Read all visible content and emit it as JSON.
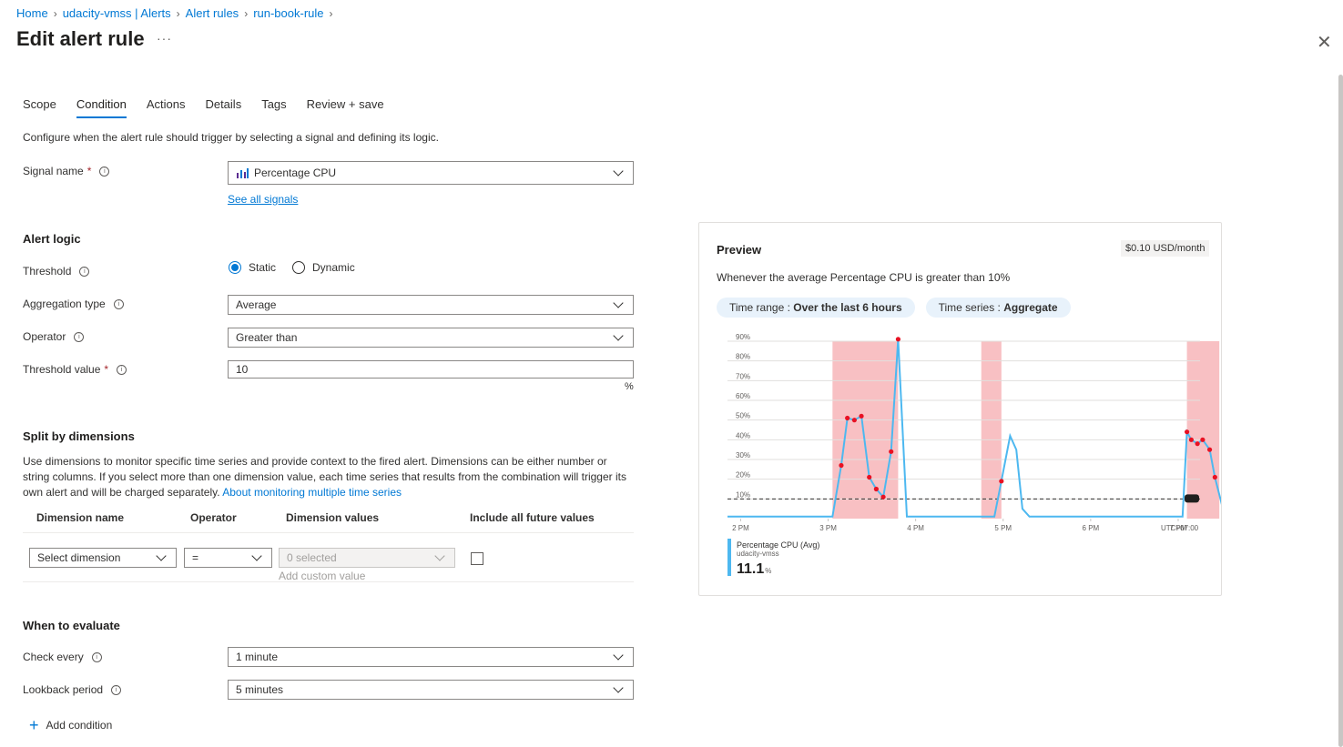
{
  "breadcrumb": [
    "Home",
    "udacity-vmss | Alerts",
    "Alert rules",
    "run-book-rule"
  ],
  "page_title": "Edit alert rule",
  "tabs": [
    "Scope",
    "Condition",
    "Actions",
    "Details",
    "Tags",
    "Review + save"
  ],
  "active_tab": "Condition",
  "description": "Configure when the alert rule should trigger by selecting a signal and defining its logic.",
  "signal": {
    "label": "Signal name",
    "value": "Percentage CPU",
    "see_all": "See all signals"
  },
  "alert_logic": {
    "heading": "Alert logic",
    "threshold_label": "Threshold",
    "threshold_options": [
      "Static",
      "Dynamic"
    ],
    "threshold_selected": "Static",
    "aggregation_label": "Aggregation type",
    "aggregation_value": "Average",
    "operator_label": "Operator",
    "operator_value": "Greater than",
    "threshold_value_label": "Threshold value",
    "threshold_value": "10",
    "unit": "%"
  },
  "split": {
    "heading": "Split by dimensions",
    "text": "Use dimensions to monitor specific time series and provide context to the fired alert. Dimensions can be either number or string columns. If you select more than one dimension value, each time series that results from the combination will trigger its own alert and will be charged separately.",
    "link": "About monitoring multiple time series",
    "columns": [
      "Dimension name",
      "Operator",
      "Dimension values",
      "Include all future values"
    ],
    "dimension_placeholder": "Select dimension",
    "operator_value": "=",
    "values_placeholder": "0 selected",
    "add_custom": "Add custom value"
  },
  "evaluate": {
    "heading": "When to evaluate",
    "check_label": "Check every",
    "check_value": "1 minute",
    "lookback_label": "Lookback period",
    "lookback_value": "5 minutes",
    "add_condition": "Add condition"
  },
  "preview": {
    "title": "Preview",
    "cost": "$0.10 USD/month",
    "summary": "Whenever the average Percentage CPU is greater than 10%",
    "time_range_label": "Time range : ",
    "time_range_value": "Over the last 6 hours",
    "time_series_label": "Time series : ",
    "time_series_value": "Aggregate",
    "legend_name": "Percentage CPU (Avg)",
    "legend_resource": "udacity-vmss",
    "legend_value": "11.1",
    "legend_unit": "%"
  },
  "chart_data": {
    "type": "line",
    "y_ticks": [
      "90%",
      "80%",
      "70%",
      "60%",
      "50%",
      "40%",
      "30%",
      "20%",
      "10%"
    ],
    "x_ticks": [
      "2 PM",
      "3 PM",
      "4 PM",
      "5 PM",
      "6 PM",
      "7 PM",
      "UTC+07:00"
    ],
    "ylim": [
      0,
      90
    ],
    "threshold": 10,
    "xlim": [
      13.85,
      19.25
    ],
    "series": [
      {
        "name": "Percentage CPU (Avg)",
        "color": "#4db8f0",
        "x": [
          13.85,
          14.3,
          14.8,
          15.05,
          15.15,
          15.22,
          15.3,
          15.38,
          15.47,
          15.55,
          15.63,
          15.72,
          15.8,
          15.9,
          16.05,
          16.3,
          16.7,
          16.9,
          16.98,
          17.08,
          17.15,
          17.22,
          17.3,
          17.6,
          18.2,
          18.7,
          18.95,
          19.05,
          19.1,
          19.15,
          19.22,
          19.28,
          19.36,
          19.42,
          19.5,
          19.56,
          19.62,
          19.68
        ],
        "y": [
          1,
          1,
          1,
          1,
          27,
          51,
          50,
          52,
          21,
          15,
          11,
          34,
          91,
          1,
          1,
          1,
          1,
          1,
          19,
          42,
          35,
          5,
          1,
          1,
          1,
          1,
          1,
          1,
          44,
          40,
          38,
          40,
          35,
          21,
          7,
          49,
          24,
          11
        ]
      }
    ],
    "alert_windows": [
      [
        15.05,
        15.8
      ],
      [
        16.75,
        16.98
      ],
      [
        19.1,
        19.47
      ],
      [
        19.5,
        19.63
      ]
    ]
  },
  "colors": {
    "accent": "#0078d4",
    "line": "#4db8f0",
    "alert_region": "#f7b5b8",
    "point": "#e81123"
  }
}
